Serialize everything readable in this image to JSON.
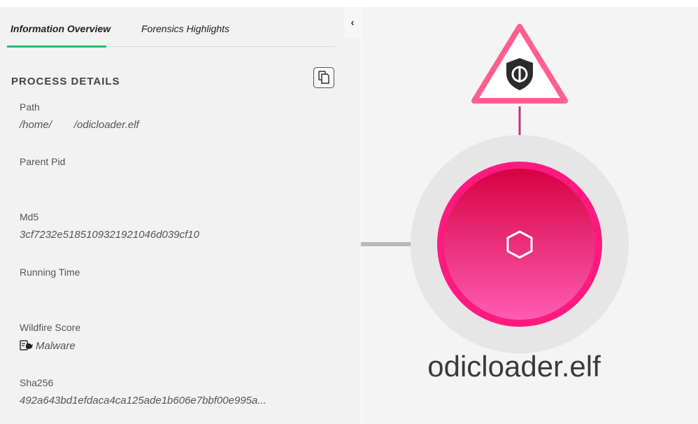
{
  "tabs": [
    {
      "label": "Information Overview",
      "active": true
    },
    {
      "label": "Forensics Highlights",
      "active": false
    }
  ],
  "collapse_glyph": "‹",
  "section_title": "PROCESS DETAILS",
  "fields": {
    "path": {
      "label": "Path",
      "value_prefix": "/home/",
      "value_suffix": "/odicloader.elf"
    },
    "parent_pid": {
      "label": "Parent Pid",
      "value": ""
    },
    "md5": {
      "label": "Md5",
      "value": "3cf7232e5185109321921046d039cf10"
    },
    "running_time": {
      "label": "Running Time",
      "value": ""
    },
    "wildfire_score": {
      "label": "Wildfire Score",
      "value": "Malware",
      "icon": "wildfire-malware-icon"
    },
    "sha256": {
      "label": "Sha256",
      "value": "492a643bd1efdaca4ca125ade1b606e7bbf00e995a..."
    }
  },
  "graph": {
    "node_label": "odicloader.elf",
    "node_icon": "hexagon-icon",
    "alert_icon": "shield-alert-icon",
    "colors": {
      "node": "#e8106b",
      "ring": "#ff2f87",
      "alert": "#ff5f8f",
      "edge": "#b9b9b9",
      "link": "#c2367a"
    }
  },
  "colors": {
    "accent_tab": "#1ec26a",
    "panel_bg": "#f2f2f2"
  }
}
